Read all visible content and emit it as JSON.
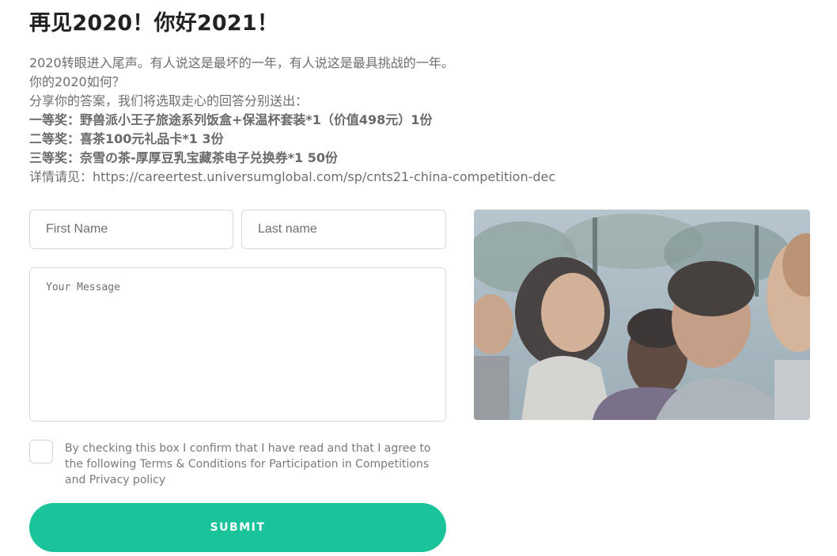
{
  "header": {
    "title": "再见2020！你好2021！"
  },
  "intro": {
    "line1": "2020转眼进入尾声。有人说这是最坏的一年，有人说这是最具挑战的一年。",
    "line2": "你的2020如何？",
    "line3": "分享你的答案，我们将选取走心的回答分别送出：",
    "prize1": "一等奖：野兽派小王子旅途系列饭盒+保温杯套装*1（价值498元）1份",
    "prize2": "二等奖：喜茶100元礼品卡*1 3份",
    "prize3": "三等奖：奈雪の茶-厚厚豆乳宝藏茶电子兑换券*1 50份",
    "details": "详情请见：https://careertest.universumglobal.com/sp/cnts21-china-competition-dec"
  },
  "form": {
    "first_name_placeholder": "First Name",
    "last_name_placeholder": "Last name",
    "message_placeholder": "Your Message",
    "consent_text": "By checking this box I confirm that I have read and that I agree to the following Terms & Conditions for Participation in Competitions and Privacy policy",
    "submit_label": "SUBMIT"
  },
  "colors": {
    "accent": "#1bc39a",
    "title": "#222222",
    "body_text": "#6e6e6e"
  }
}
